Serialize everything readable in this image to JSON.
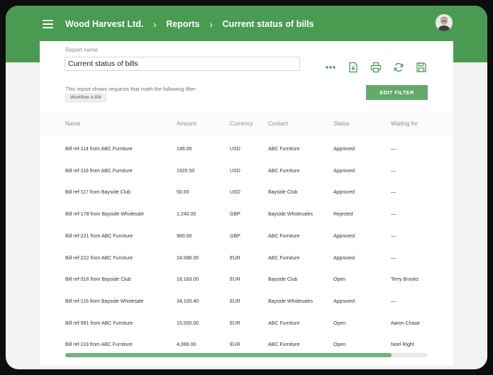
{
  "header": {
    "breadcrumbs": [
      "Wood Harvest Ltd.",
      "Reports",
      "Current status of bills"
    ],
    "separator": "›"
  },
  "report": {
    "name_label": "Report name",
    "name_value": "Current status of bills",
    "filter_text": "This report shows requests that math the following filter:",
    "filter_chip": "Workflow is Bill",
    "edit_filter_label": "EDIT FILTER"
  },
  "toolbar": {
    "icons": [
      "more-dots-icon",
      "download-icon",
      "print-icon",
      "refresh-icon",
      "save-icon"
    ]
  },
  "table": {
    "columns": [
      "Name",
      "Amount",
      "Currency",
      "Contact",
      "Status",
      "Waiting for"
    ],
    "rows": [
      [
        "Bill ref-114 from ABC Furniture",
        "146.00",
        "USD",
        "ABC Furniture",
        "Approved",
        "—"
      ],
      [
        "Bill ref-116 from ABC Furniture",
        "1920.50",
        "USD",
        "ABC Furniture",
        "Approved",
        "—"
      ],
      [
        "Bill ref-117 from Bayside Club",
        "50.00",
        "USD",
        "Bayside Club",
        "Approved",
        "—"
      ],
      [
        "Bill ref-178 from Bayside Wholesale",
        "1,240.00",
        "GBP",
        "Bayside Wholesales",
        "Rejected",
        "—"
      ],
      [
        "Bill ref-221 from ABC Furniture",
        "960.00",
        "GBP",
        "ABC Furniture",
        "Approved",
        "—"
      ],
      [
        "Bill ref-222 from ABC Furniture",
        "24,086.00",
        "EUR",
        "ABC Furniture",
        "Approved",
        "—"
      ],
      [
        "Bill ref-316 from Bayside Club",
        "18,183.00",
        "EUR",
        "Bayside Club",
        "Open",
        "Terry Brooks"
      ],
      [
        "Bill ref-116 from Bayside Wholesale",
        "34,100.40",
        "EUR",
        "Bayside Wholesales",
        "Approved",
        "—"
      ],
      [
        "Bill ref-991 from ABC Furniture",
        "15,000.00",
        "EUR",
        "ABC Furniture",
        "Open",
        "Aaron Chase"
      ],
      [
        "Bill ref-119 from ABC Furniture",
        "4,086.00",
        "EUR",
        "ABC Furniture",
        "Open",
        "Noel Right"
      ]
    ]
  },
  "scroll": {
    "position_fraction": 0.9
  },
  "colors": {
    "brand": "#4a9a52",
    "button": "#62a96a",
    "scroll_thumb": "#6fb67a"
  }
}
